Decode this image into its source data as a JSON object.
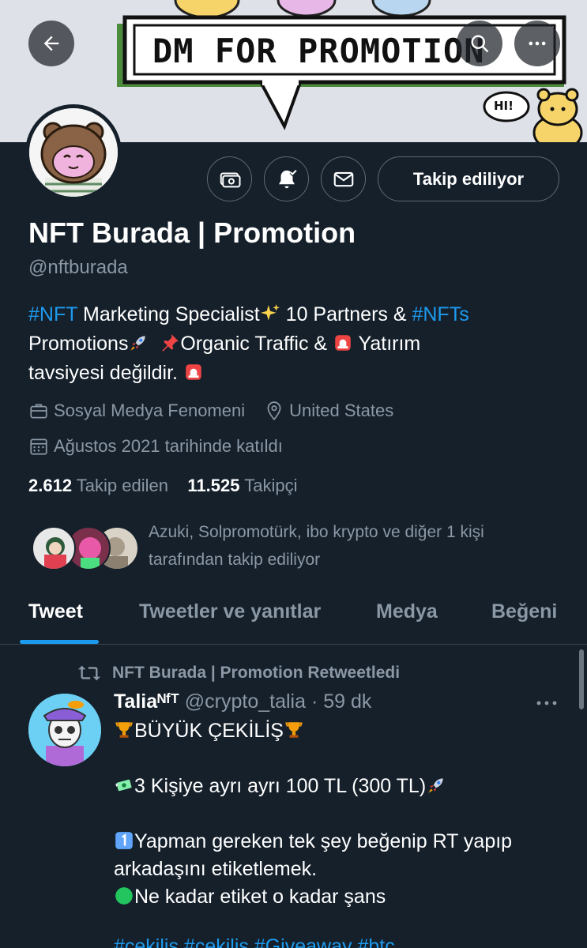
{
  "header": {
    "banner_text": "DM FOR PROMOTION",
    "banner_bubble_text": "HI!",
    "back_icon": "arrow-left-icon",
    "search_icon": "search-icon",
    "more_icon": "more-horizontal-icon"
  },
  "profile": {
    "name": "NFT Burada | Promotion",
    "handle": "@nftburada",
    "follow_button": "Takip ediliyor",
    "bio": {
      "tag1": "#NFT",
      "text1": " Marketing Specialist",
      "text2": " 10 Partners & ",
      "tag2": "#NFTs",
      "text3": "Promotions",
      "text4": "Organic Traffic & ",
      "text5": " Yatırım",
      "text6": "tavsiyesi değildir. "
    },
    "category": "Sosyal Medya Fenomeni",
    "location": "United States",
    "joined": "Ağustos 2021 tarihinde katıldı",
    "following_count": "2.612",
    "following_label": "Takip edilen",
    "followers_count": "11.525",
    "followers_label": "Takipçi",
    "followed_by_line1": "Azuki, Solpromotürk, ibo krypto ve diğer 1 kişi",
    "followed_by_line2": "tarafından takip ediliyor"
  },
  "tabs": [
    {
      "label": "Tweet",
      "active": true
    },
    {
      "label": "Tweetler ve yanıtlar",
      "active": false
    },
    {
      "label": "Medya",
      "active": false
    },
    {
      "label": "Beğeni",
      "active": false
    }
  ],
  "tweet": {
    "retweet_label": "NFT Burada | Promotion Retweetledi",
    "author_name": "Taliaᴺᶠᵀ",
    "author_handle": "@crypto_talia",
    "time": " · 59 dk",
    "line1": "BÜYÜK ÇEKİLİŞ",
    "line2": "3 Kişiye ayrı ayrı 100 TL (300 TL)",
    "line3": "Yapman gereken tek şey beğenip RT yapıp",
    "line4": "arkadaşını etiketlemek.",
    "line5": "Ne kadar etiket o kadar şans",
    "tags": "#cekilis #cekilis #Giveaway #btc"
  },
  "colors": {
    "background": "#15202b",
    "accent": "#1d9bf0",
    "secondary_text": "#8b98a5",
    "border": "#38444d"
  }
}
